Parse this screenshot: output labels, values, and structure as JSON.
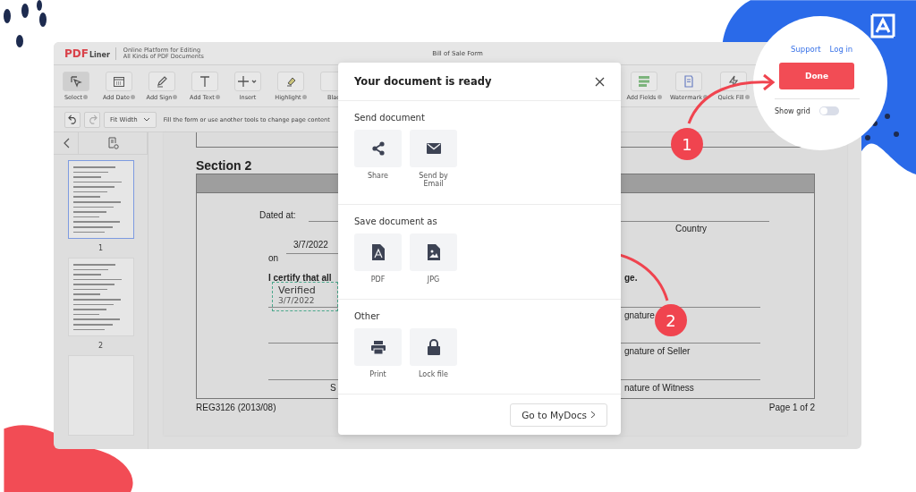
{
  "app": {
    "logo_mark": "PDF",
    "logo_sub": "Liner",
    "tagline": [
      "Online Platform for Editing",
      "All Kinds of PDF Documents"
    ],
    "title": "Bill of Sale Form"
  },
  "toolbar_left": [
    {
      "label": "Select",
      "kind": "select",
      "selected": true,
      "help": true
    },
    {
      "label": "Add Date",
      "kind": "date",
      "selected": false,
      "help": true
    },
    {
      "label": "Add Sign",
      "kind": "sign",
      "selected": false,
      "help": true
    },
    {
      "label": "Add Text",
      "kind": "text",
      "selected": false,
      "help": true
    },
    {
      "label": "Insert",
      "kind": "insert",
      "selected": false,
      "help": false
    },
    {
      "label": "Highlight",
      "kind": "highlight",
      "selected": false,
      "help": true
    },
    {
      "label": "Blac",
      "kind": "hidden",
      "selected": false,
      "help": false
    }
  ],
  "toolbar_right": [
    {
      "label": "Add Fields",
      "kind": "fields",
      "selected": false,
      "help": true
    },
    {
      "label": "Watermark",
      "kind": "watermark",
      "selected": false,
      "help": true
    },
    {
      "label": "Quick Fill",
      "kind": "quickfill",
      "selected": false,
      "help": true
    }
  ],
  "header_links": [
    "Support",
    "Log in"
  ],
  "done_button": "Done",
  "show_grid": {
    "label": "Show grid",
    "on": false
  },
  "subbar": {
    "zoom": "Fit Width",
    "hint": "Fill the form or use another tools to change page content"
  },
  "pages": [
    {
      "number": "1",
      "selected": true
    },
    {
      "number": "2",
      "selected": false
    }
  ],
  "document": {
    "section": "Section 2",
    "dated_at": "Dated at:",
    "country": "Country",
    "on": "on",
    "date": "3/7/2022",
    "certify": "I certify that all",
    "certify_end": "ge.",
    "stamp": {
      "title": "Verified",
      "date": "3/7/2022"
    },
    "sig_1": "gnature",
    "sig_2": "gnature of Seller",
    "sig_3": "nature of Witness",
    "sig_left": "S",
    "form_code": "REG3126 (2013/08)",
    "page_label": "Page 1 of 2"
  },
  "modal": {
    "title": "Your document is ready",
    "sections": [
      {
        "heading": "Send document",
        "actions": [
          {
            "label": "Share",
            "kind": "share"
          },
          {
            "label": "Send by Email",
            "kind": "email"
          }
        ]
      },
      {
        "heading": "Save document as",
        "actions": [
          {
            "label": "PDF",
            "kind": "pdf"
          },
          {
            "label": "JPG",
            "kind": "jpg"
          }
        ]
      },
      {
        "heading": "Other",
        "actions": [
          {
            "label": "Print",
            "kind": "print"
          },
          {
            "label": "Lock file",
            "kind": "lock"
          }
        ]
      }
    ],
    "footer_button": "Go to MyDocs"
  },
  "steps": [
    "1",
    "2"
  ]
}
